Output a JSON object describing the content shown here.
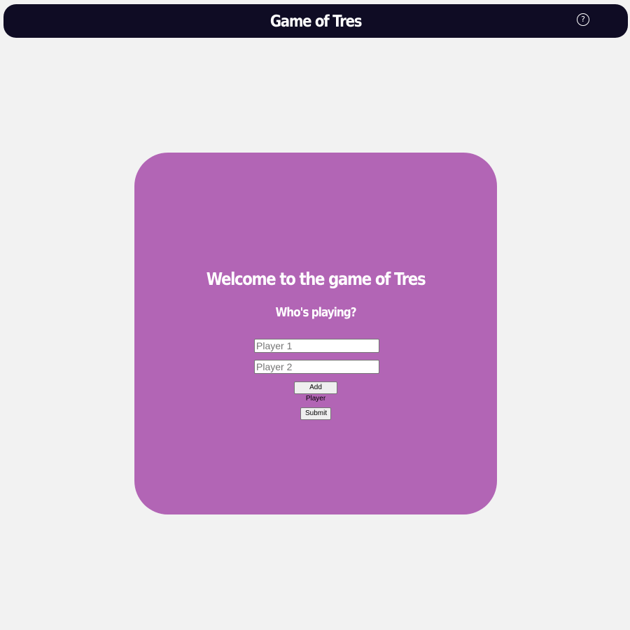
{
  "header": {
    "title": "Game of Tres",
    "help_icon": "?",
    "background": "#0f0c24"
  },
  "card": {
    "background": "#b265b5",
    "welcome": "Welcome to the game of Tres",
    "prompt": "Who's playing?",
    "players": [
      {
        "placeholder": "Player 1",
        "value": ""
      },
      {
        "placeholder": "Player 2",
        "value": ""
      }
    ],
    "add_player_label": "Add Player",
    "submit_label": "Submit"
  },
  "page_background": "#f2f2f2"
}
